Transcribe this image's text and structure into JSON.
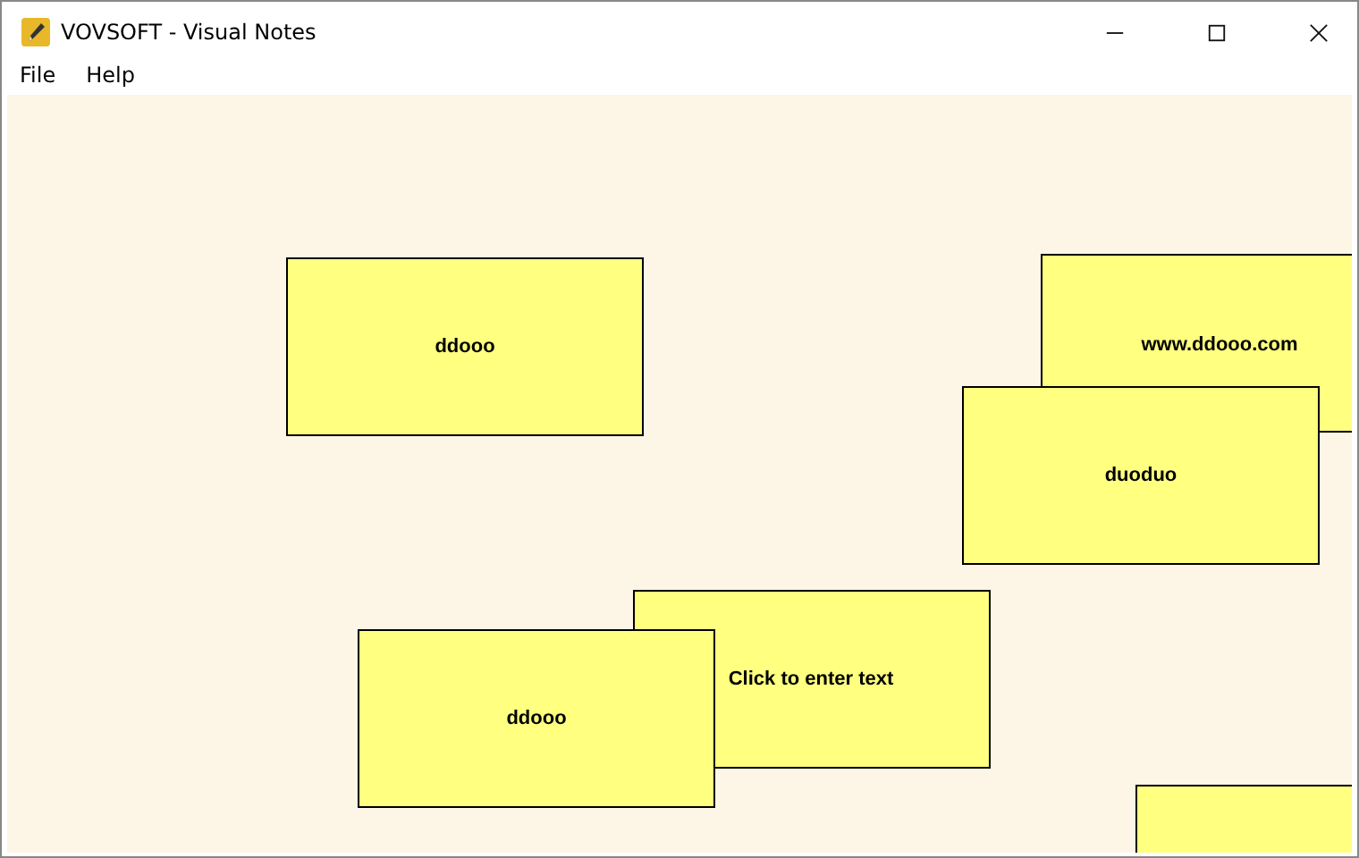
{
  "window": {
    "title": "VOVSOFT - Visual Notes"
  },
  "menu": [
    "File",
    "Help"
  ],
  "notes": [
    {
      "kind": "text",
      "text": "ddooo"
    },
    {
      "kind": "text",
      "text": "www.ddooo.com"
    },
    {
      "kind": "text",
      "text": "duoduo"
    },
    {
      "kind": "text",
      "text": "Click to enter text"
    },
    {
      "kind": "text",
      "text": "ddooo"
    },
    {
      "kind": "blank"
    }
  ]
}
